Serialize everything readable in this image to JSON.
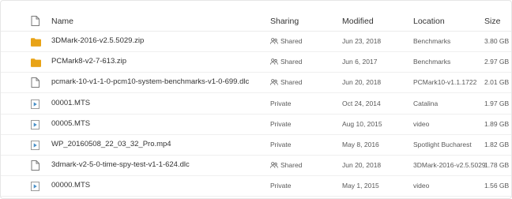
{
  "header": {
    "name": "Name",
    "sharing": "Sharing",
    "modified": "Modified",
    "location": "Location",
    "size": "Size"
  },
  "rows": [
    {
      "icon": "folder-zip-icon",
      "name": "3DMark-2016-v2.5.5029.zip",
      "sharing": "Shared",
      "shared": true,
      "modified": "Jun 23, 2018",
      "location": "Benchmarks",
      "size": "3.80 GB"
    },
    {
      "icon": "folder-zip-icon",
      "name": "PCMark8-v2-7-613.zip",
      "sharing": "Shared",
      "shared": true,
      "modified": "Jun 6, 2017",
      "location": "Benchmarks",
      "size": "2.97 GB"
    },
    {
      "icon": "document-icon",
      "name": "pcmark-10-v1-1-0-pcm10-system-benchmarks-v1-0-699.dlc",
      "sharing": "Shared",
      "shared": true,
      "modified": "Jun 20, 2018",
      "location": "PCMark10-v1.1.1722",
      "size": "2.01 GB"
    },
    {
      "icon": "video-file-icon",
      "name": "00001.MTS",
      "sharing": "Private",
      "shared": false,
      "modified": "Oct 24, 2014",
      "location": "Catalina",
      "size": "1.97 GB"
    },
    {
      "icon": "video-file-icon",
      "name": "00005.MTS",
      "sharing": "Private",
      "shared": false,
      "modified": "Aug 10, 2015",
      "location": "video",
      "size": "1.89 GB"
    },
    {
      "icon": "video-file-icon",
      "name": "WP_20160508_22_03_32_Pro.mp4",
      "sharing": "Private",
      "shared": false,
      "modified": "May 8, 2016",
      "location": "Spotlight Bucharest",
      "size": "1.82 GB"
    },
    {
      "icon": "document-icon",
      "name": "3dmark-v2-5-0-time-spy-test-v1-1-624.dlc",
      "sharing": "Shared",
      "shared": true,
      "modified": "Jun 20, 2018",
      "location": "3DMark-2016-v2.5.5029",
      "size": "1.78 GB"
    },
    {
      "icon": "video-file-icon",
      "name": "00000.MTS",
      "sharing": "Private",
      "shared": false,
      "modified": "May 1, 2015",
      "location": "video",
      "size": "1.56 GB"
    }
  ],
  "colors": {
    "folder": "#e8a317",
    "video_icon": "#4a90c8",
    "doc_outline": "#7a7a7a"
  }
}
